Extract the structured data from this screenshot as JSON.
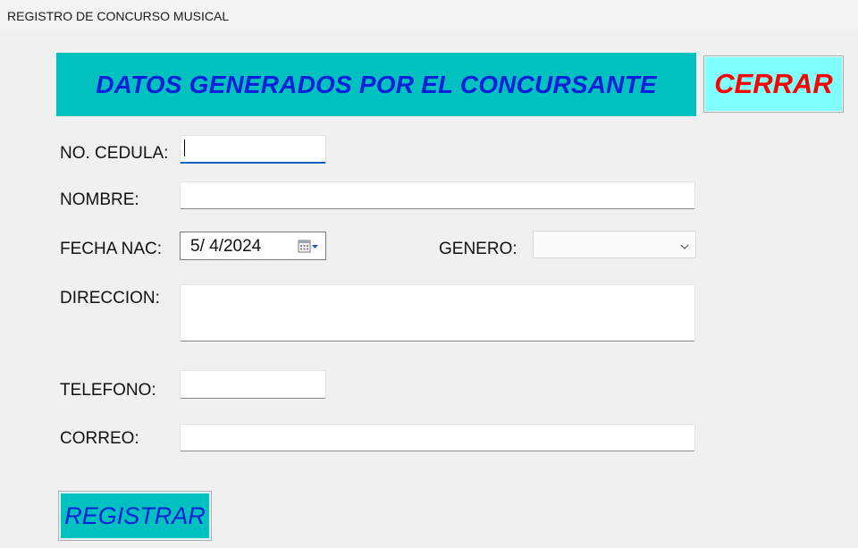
{
  "window": {
    "title": "REGISTRO DE CONCURSO MUSICAL"
  },
  "header": {
    "banner": "DATOS GENERADOS POR EL CONCURSANTE",
    "close_label": "CERRAR"
  },
  "form": {
    "cedula_label": "NO. CEDULA:",
    "cedula_value": "",
    "nombre_label": "NOMBRE:",
    "nombre_value": "",
    "fecha_label": "FECHA NAC:",
    "fecha_value": "5/  4/2024",
    "genero_label": "GENERO:",
    "genero_value": "",
    "direccion_label": "DIRECCION:",
    "direccion_value": "",
    "telefono_label": "TELEFONO:",
    "telefono_value": "",
    "correo_label": "CORREO:",
    "correo_value": ""
  },
  "actions": {
    "register_label": "REGISTRAR"
  },
  "colors": {
    "banner_bg": "#00c0c0",
    "banner_text": "#0a1fd9",
    "close_bg": "#80ffff",
    "close_text": "#ff0000",
    "register_bg": "#00c0c0"
  },
  "icons": {
    "date_picker": "calendar-icon",
    "combo": "chevron-down-icon"
  }
}
